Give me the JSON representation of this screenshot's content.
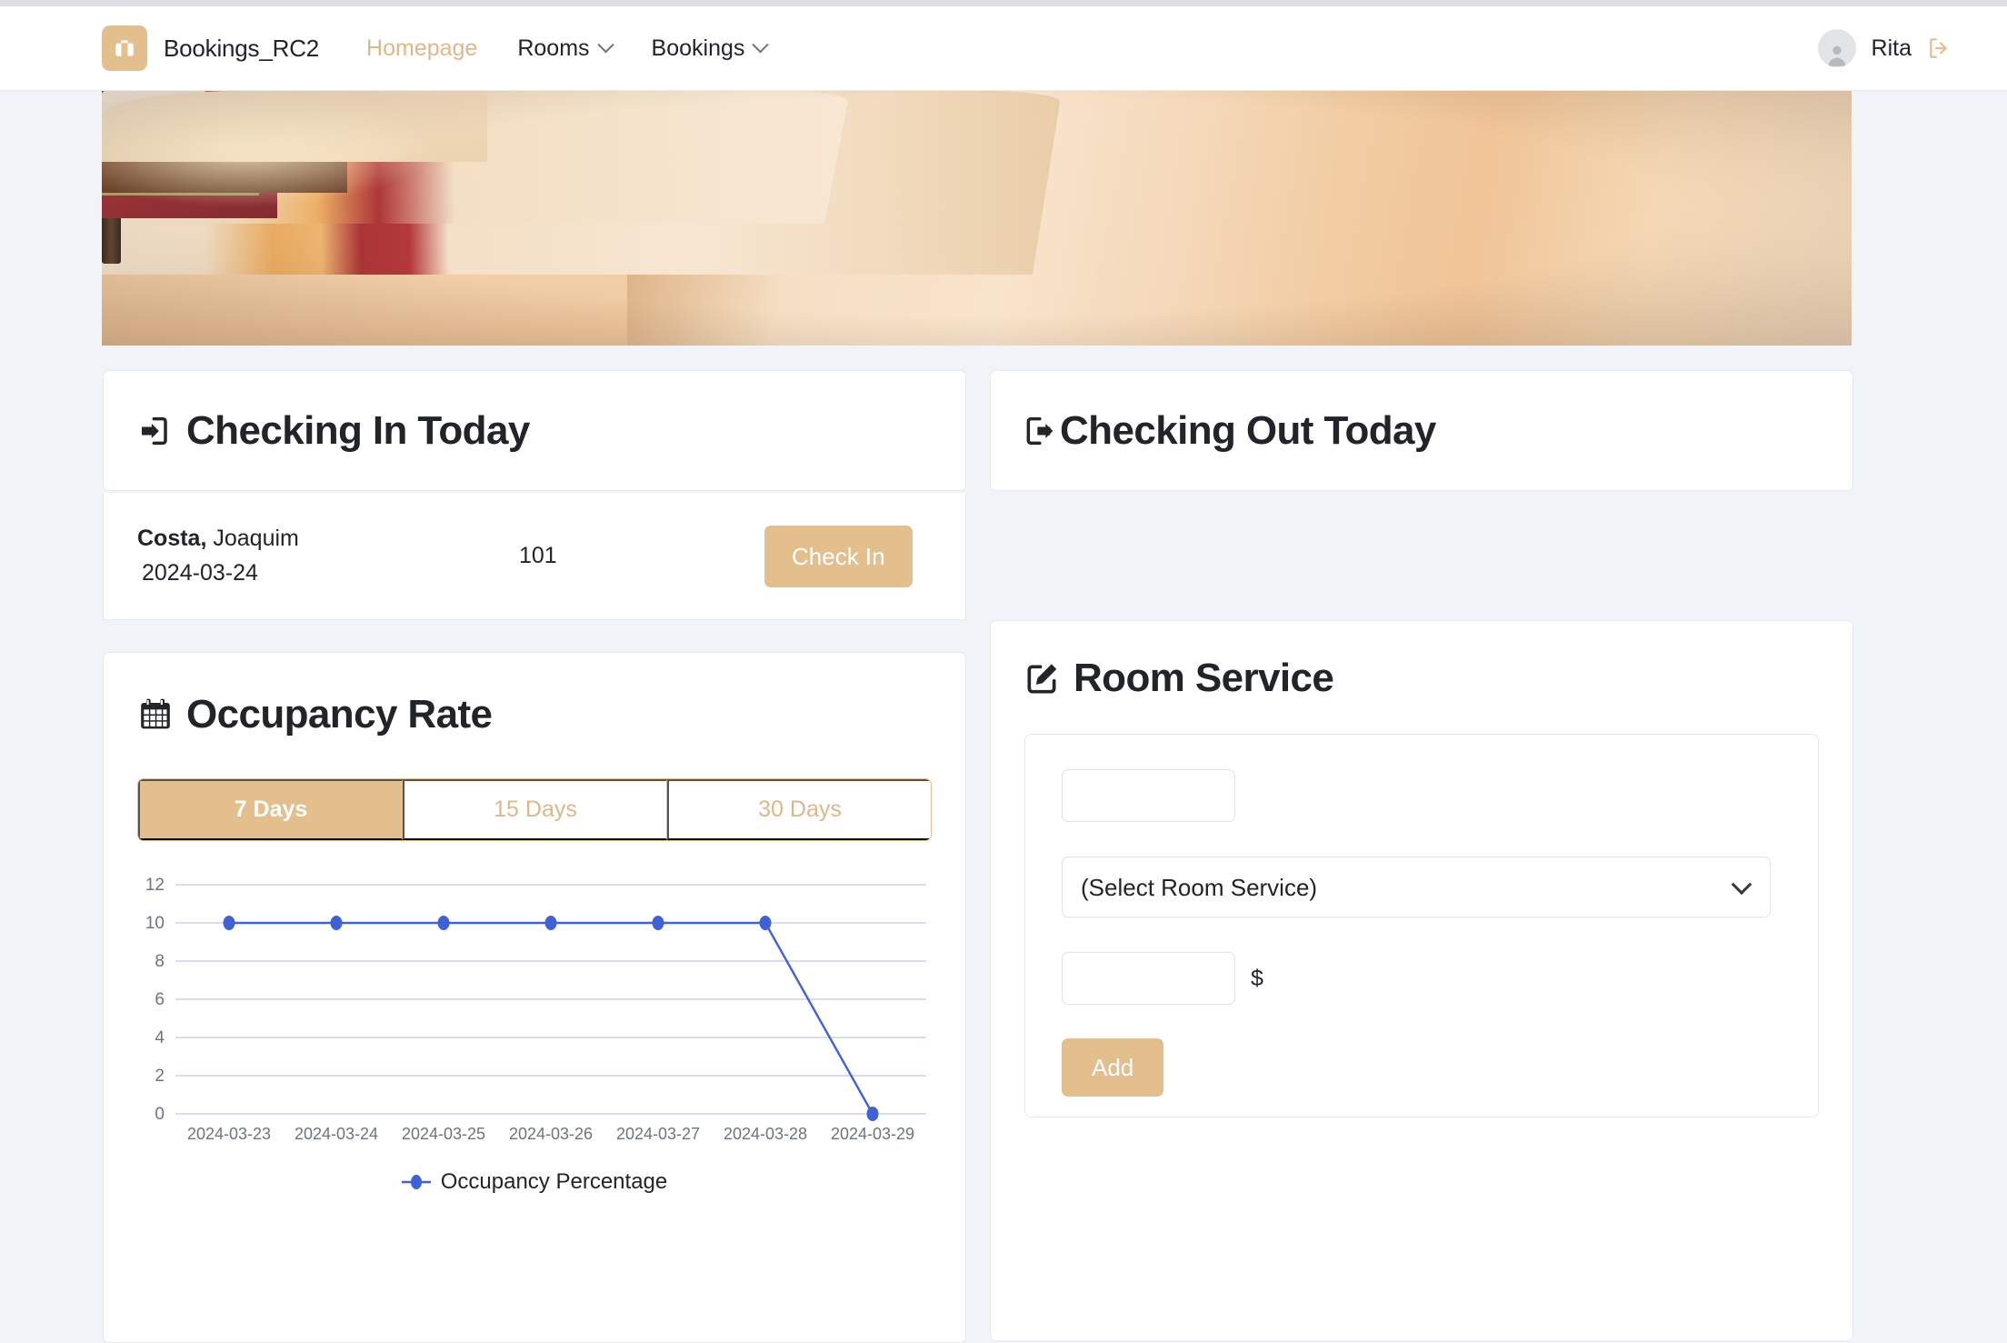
{
  "navbar": {
    "logo_icon": "suitcase-icon",
    "brand": "Bookings_RC2",
    "links": [
      {
        "label": "Homepage",
        "active": true,
        "has_dropdown": false
      },
      {
        "label": "Rooms",
        "active": false,
        "has_dropdown": true
      },
      {
        "label": "Bookings",
        "active": false,
        "has_dropdown": true
      }
    ],
    "user": "Rita",
    "avatar_icon": "user-avatar-icon",
    "logout_icon": "logout-icon"
  },
  "hero": {
    "alt": "hotel-room-photo"
  },
  "checking_in": {
    "icon": "sign-in-icon",
    "title": "Checking In Today",
    "rows": [
      {
        "last_name": "Costa,",
        "first_name": "Joaquim",
        "date": "2024-03-24",
        "room": "101",
        "action_label": "Check In"
      }
    ]
  },
  "checking_out": {
    "icon": "sign-out-icon",
    "title": "Checking Out Today",
    "rows": []
  },
  "occupancy": {
    "icon": "calendar-icon",
    "title": "Occupancy Rate",
    "range_options": [
      {
        "label": "7 Days",
        "active": true
      },
      {
        "label": "15 Days",
        "active": false
      },
      {
        "label": "30 Days",
        "active": false
      }
    ]
  },
  "chart_data": {
    "type": "line",
    "title": "",
    "xlabel": "",
    "ylabel": "",
    "x": [
      "2024-03-23",
      "2024-03-24",
      "2024-03-25",
      "2024-03-26",
      "2024-03-27",
      "2024-03-28",
      "2024-03-29"
    ],
    "series": [
      {
        "name": "Occupancy Percentage",
        "values": [
          10,
          10,
          10,
          10,
          10,
          10,
          0
        ],
        "color": "#3f61d8"
      }
    ],
    "yticks": [
      0,
      2,
      4,
      6,
      8,
      10,
      12
    ],
    "ylim": [
      0,
      12
    ],
    "grid": true,
    "legend_position": "bottom"
  },
  "room_service": {
    "icon": "edit-square-icon",
    "title": "Room Service",
    "room_input": {
      "value": "",
      "placeholder": ""
    },
    "service_select": {
      "selected": "(Select Room Service)",
      "options": [
        "(Select Room Service)"
      ]
    },
    "price_input": {
      "value": "",
      "placeholder": ""
    },
    "currency_symbol": "$",
    "add_label": "Add"
  },
  "colors": {
    "accent": "#e2bf8d",
    "accent_text": "#dfb787",
    "page_bg": "#f0f4f8",
    "card_bg": "#ffffff",
    "chart_line": "#3f61d8",
    "text": "#212529"
  }
}
